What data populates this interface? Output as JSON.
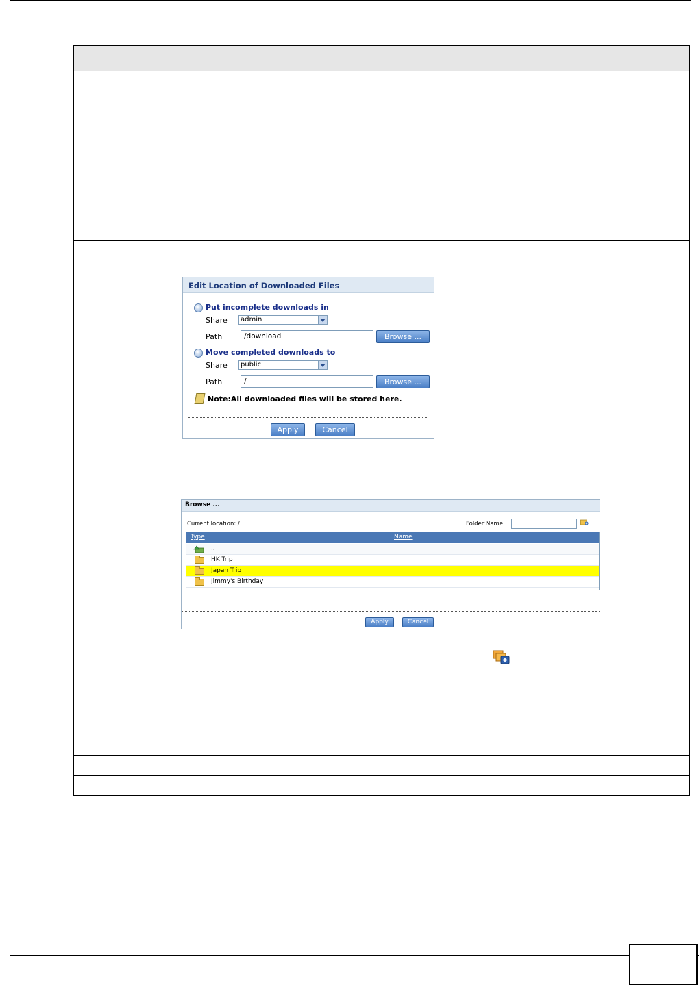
{
  "dialog_edit_location": {
    "title": "Edit Location of Downloaded Files",
    "incomplete_label": "Put incomplete downloads in",
    "share_label_1": "Share",
    "share_value_1": "admin",
    "path_label_1": "Path",
    "path_value_1": "/download",
    "browse_label_1": "Browse ...",
    "completed_label": "Move completed downloads to",
    "share_label_2": "Share",
    "share_value_2": "public",
    "path_label_2": "Path",
    "path_value_2": "/",
    "browse_label_2": "Browse ...",
    "note": "Note:All downloaded files will be stored here.",
    "apply_label": "Apply",
    "cancel_label": "Cancel"
  },
  "dialog_browse": {
    "title": "Browse ...",
    "current_location": "Current location: /",
    "folder_name_label": "Folder Name:",
    "folder_name_value": "",
    "col_type": "Type",
    "col_name": "Name",
    "rows": [
      {
        "name": "..",
        "icon": "up-folder-icon",
        "selected": false
      },
      {
        "name": "HK Trip",
        "icon": "folder-icon",
        "selected": false
      },
      {
        "name": "Japan Trip",
        "icon": "folder-icon",
        "selected": true
      },
      {
        "name": "Jimmy's Birthday",
        "icon": "folder-icon",
        "selected": false
      }
    ],
    "apply_label": "Apply",
    "cancel_label": "Cancel",
    "highlight_color": "#ffff00",
    "header_color": "#4a78b5"
  }
}
